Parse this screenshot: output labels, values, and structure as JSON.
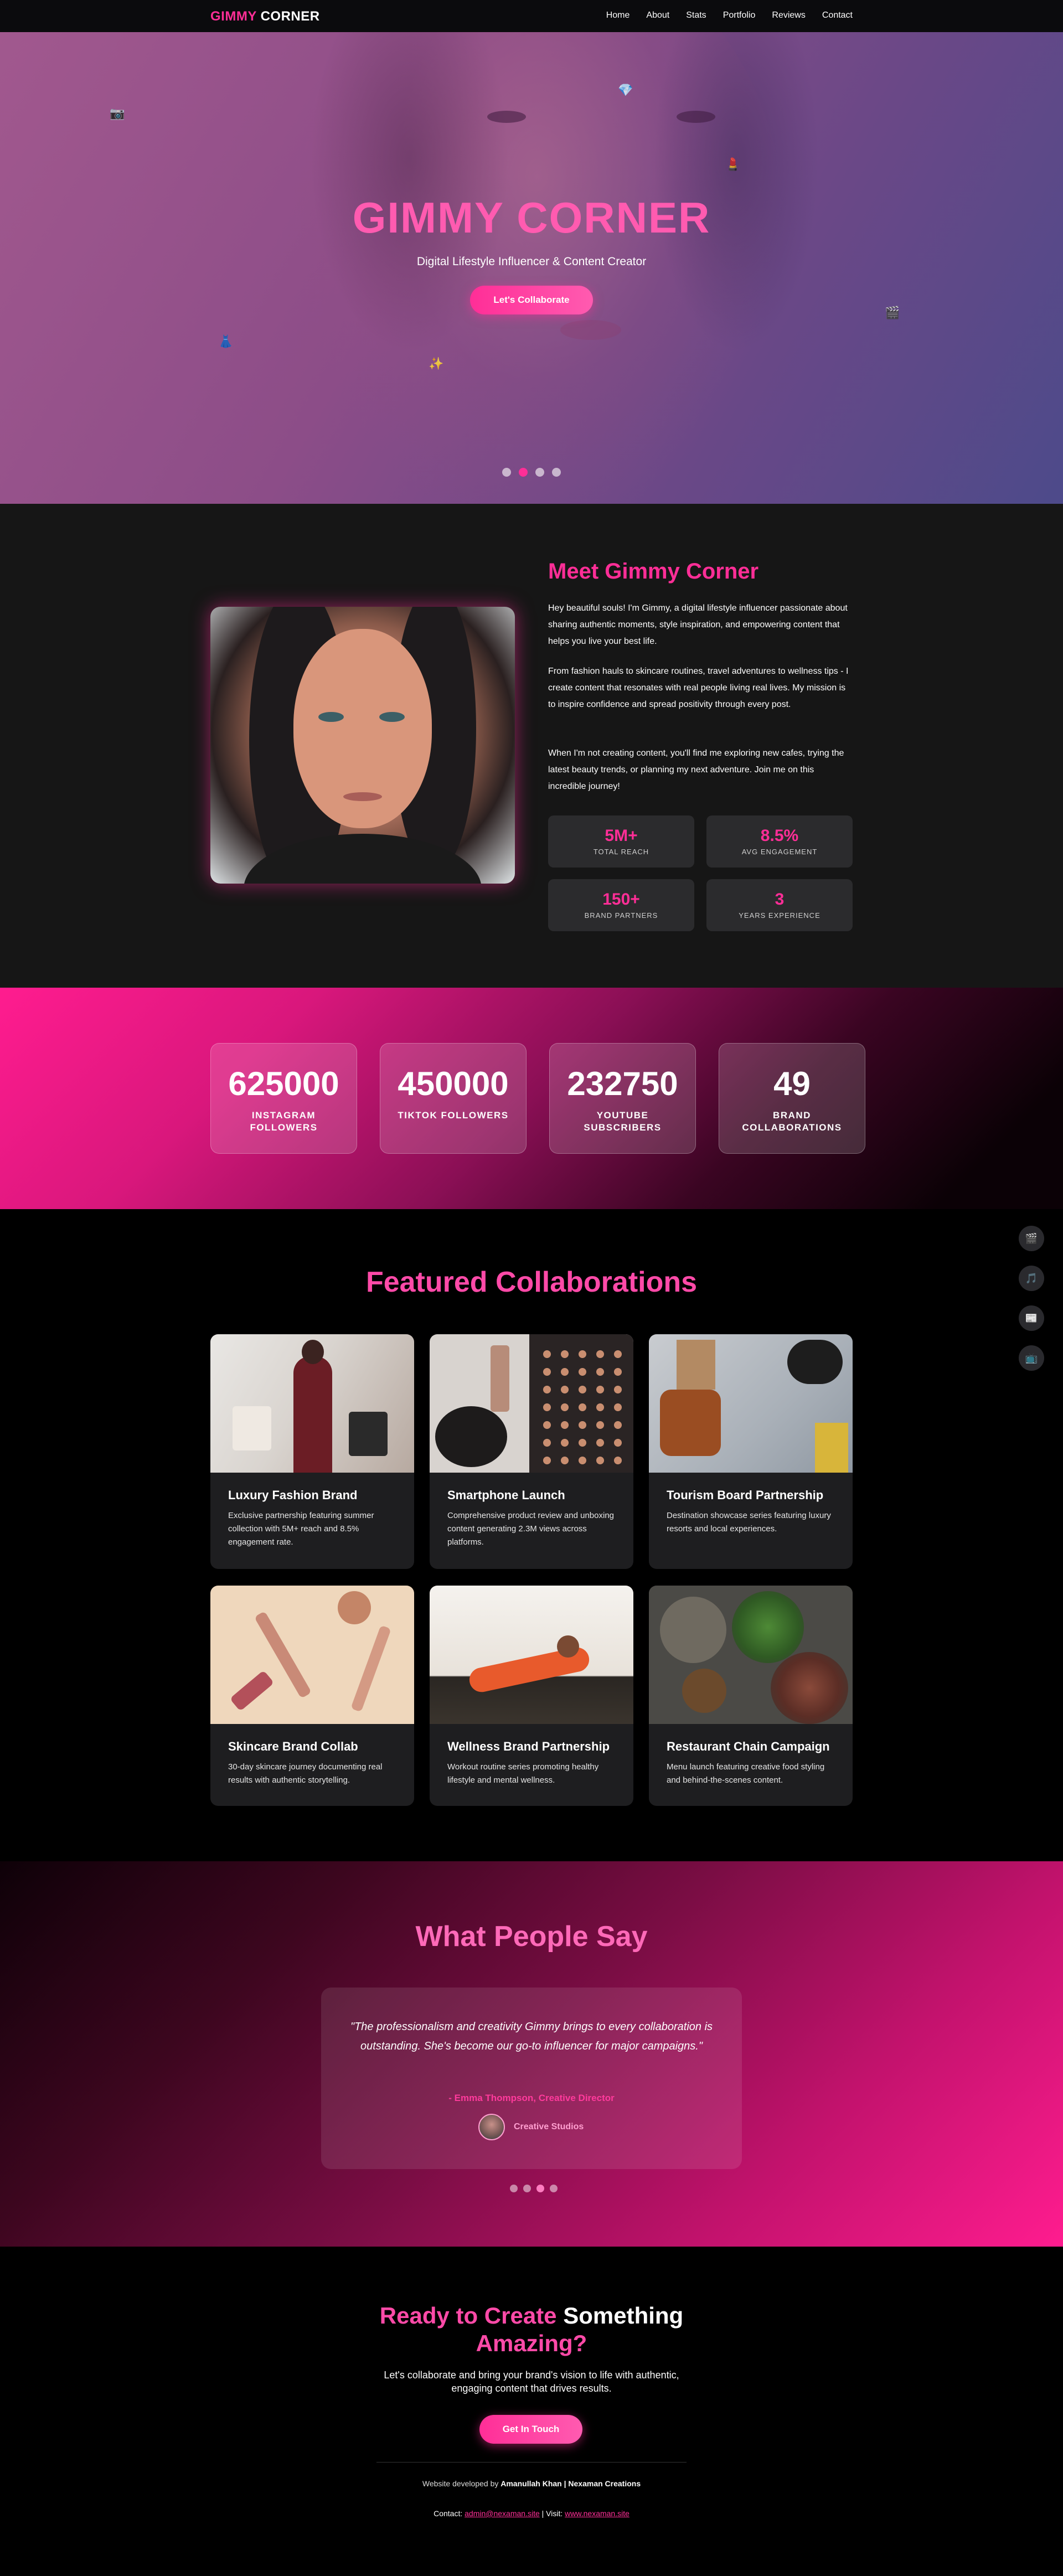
{
  "nav": {
    "logo_part1": "GIMMY",
    "logo_part2": "CORNER",
    "links": [
      "Home",
      "About",
      "Stats",
      "Portfolio",
      "Reviews",
      "Contact"
    ]
  },
  "hero": {
    "title": "GIMMY CORNER",
    "subtitle": "Digital Lifestyle Influencer & Content Creator",
    "cta_label": "Let's Collaborate",
    "decor_icons": [
      "camera-icon",
      "gem-icon",
      "lipstick-icon",
      "dress-icon",
      "sparkles-icon",
      "film-icon"
    ],
    "slide_count": 4,
    "active_slide": 2
  },
  "about": {
    "heading": "Meet Gimmy Corner",
    "paragraphs": [
      "Hey beautiful souls! I'm Gimmy, a digital lifestyle influencer passionate about sharing authentic moments, style inspiration, and empowering content that helps you live your best life.",
      "From fashion hauls to skincare routines, travel adventures to wellness tips - I create content that resonates with real people living real lives. My mission is to inspire confidence and spread positivity through every post.",
      "When I'm not creating content, you'll find me exploring new cafes, trying the latest beauty trends, or planning my next adventure. Join me on this incredible journey!"
    ],
    "stats": [
      {
        "value": "5M+",
        "label": "TOTAL REACH"
      },
      {
        "value": "8.5%",
        "label": "AVG ENGAGEMENT"
      },
      {
        "value": "150+",
        "label": "BRAND PARTNERS"
      },
      {
        "value": "3",
        "label": "YEARS EXPERIENCE"
      }
    ]
  },
  "counters": [
    {
      "number": "625000",
      "label": "INSTAGRAM FOLLOWERS"
    },
    {
      "number": "450000",
      "label": "TIKTOK FOLLOWERS"
    },
    {
      "number": "232750",
      "label": "YOUTUBE SUBSCRIBERS"
    },
    {
      "number": "49",
      "label": "BRAND COLLABORATIONS"
    }
  ],
  "collabs": {
    "heading": "Featured Collaborations",
    "cards": [
      {
        "title": "Luxury Fashion Brand",
        "text": "Exclusive partnership featuring summer collection with 5M+ reach and 8.5% engagement rate."
      },
      {
        "title": "Smartphone Launch",
        "text": "Comprehensive product review and unboxing content generating 2.3M views across platforms."
      },
      {
        "title": "Tourism Board Partnership",
        "text": "Destination showcase series featuring luxury resorts and local experiences."
      },
      {
        "title": "Skincare Brand Collab",
        "text": "30-day skincare journey documenting real results with authentic storytelling."
      },
      {
        "title": "Wellness Brand Partnership",
        "text": "Workout routine series promoting healthy lifestyle and mental wellness."
      },
      {
        "title": "Restaurant Chain Campaign",
        "text": "Menu launch featuring creative food styling and behind-the-scenes content."
      }
    ],
    "side_icons": [
      "film-icon",
      "music-icon",
      "newspaper-icon",
      "tv-icon"
    ]
  },
  "testimonials": {
    "heading": "What People Say",
    "quote": "\"The professionalism and creativity Gimmy brings to every collaboration is outstanding. She's become our go-to influencer for major campaigns.\"",
    "author": "- Emma Thompson, Creative Director",
    "company": "Creative Studios",
    "slide_count": 4,
    "active_slide": 3
  },
  "cta": {
    "heading_pink_1": "Ready to Create",
    "heading_white": "Something",
    "heading_pink_2": "Amazing?",
    "text": "Let's collaborate and bring your brand's vision to life with authentic, engaging content that drives results.",
    "button": "Get In Touch"
  },
  "footer": {
    "dev_prefix": "Website developed by",
    "dev_name": "Amanullah Khan | Nexaman Creations",
    "contact_prefix": "Contact:",
    "contact_email": "admin@nexaman.site",
    "visit_prefix": "| Visit:",
    "visit_url": "www.nexaman.site"
  },
  "colors": {
    "accent": "#ff2e97",
    "accent_light": "#ff5bb0",
    "card_bg": "#1e1e20",
    "section_dark": "#161616"
  }
}
